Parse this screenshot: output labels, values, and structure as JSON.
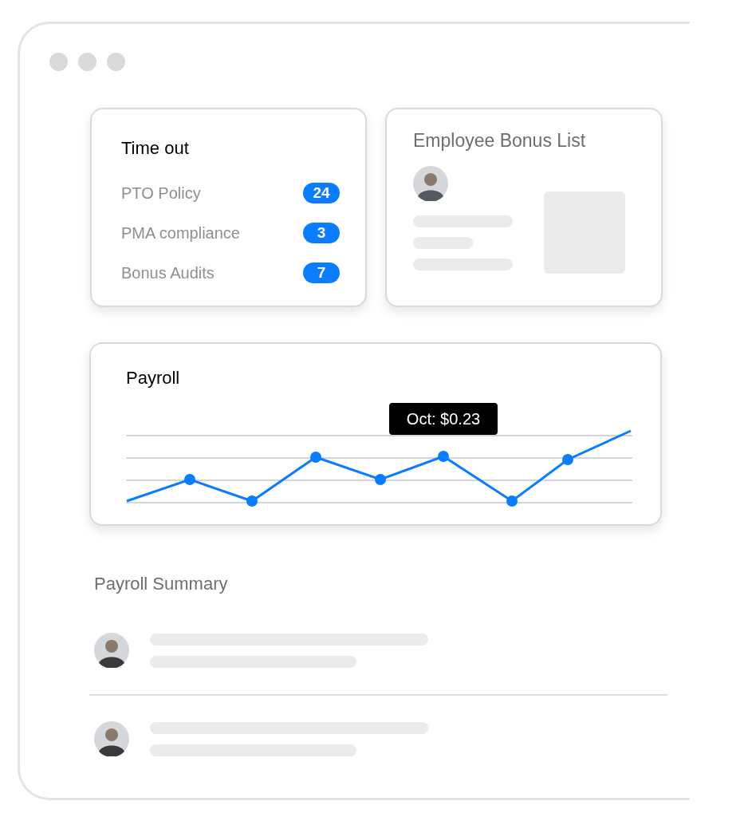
{
  "time_out": {
    "title": "Time out",
    "items": [
      {
        "label": "PTO Policy",
        "count": "24"
      },
      {
        "label": "PMA compliance",
        "count": "3"
      },
      {
        "label": "Bonus Audits",
        "count": "7"
      }
    ]
  },
  "bonus_list": {
    "title": "Employee Bonus List"
  },
  "payroll": {
    "title": "Payroll",
    "tooltip": "Oct: $0.23"
  },
  "summary": {
    "title": "Payroll Summary",
    "rows": [
      {
        "kind": "person"
      },
      {
        "kind": "person"
      }
    ]
  }
}
